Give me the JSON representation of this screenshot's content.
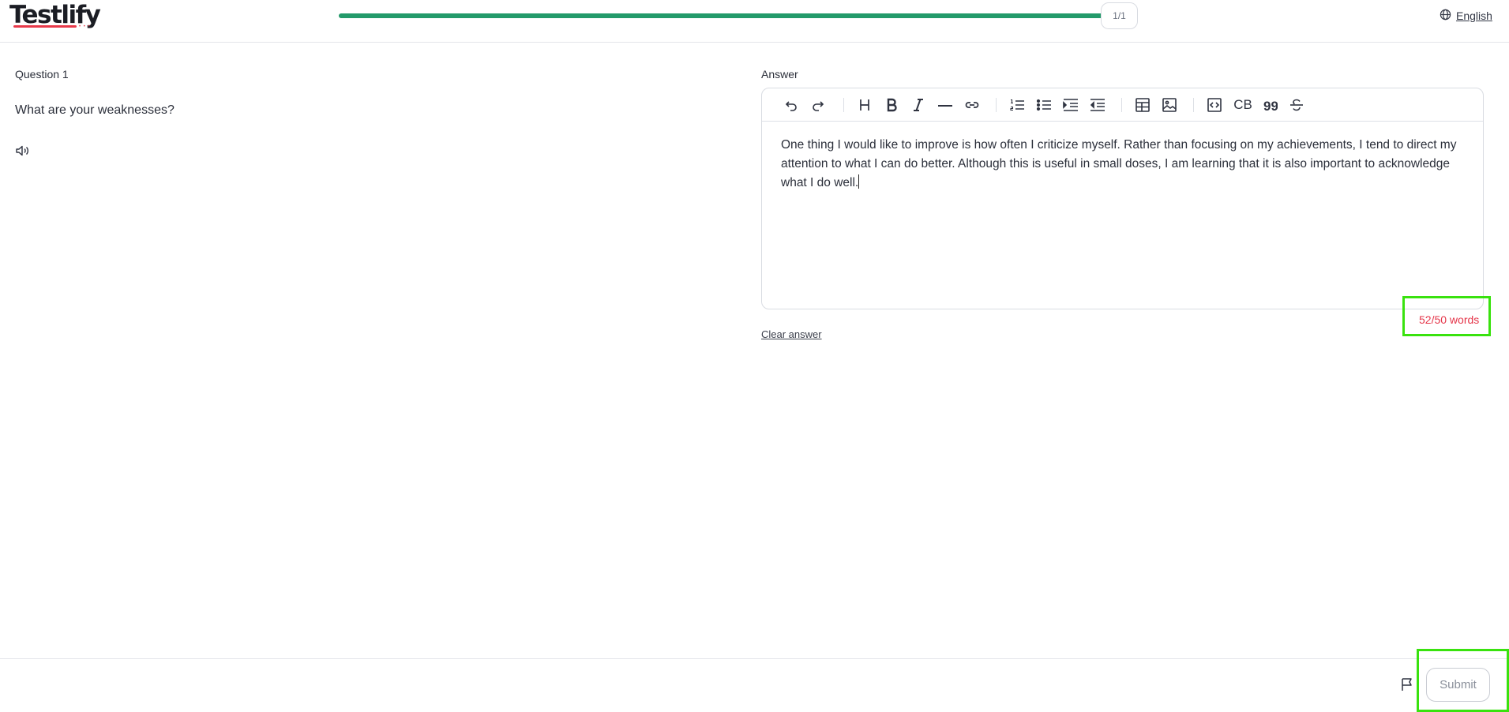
{
  "header": {
    "logo_text": "Testlify",
    "progress_label": "1/1",
    "progress_fraction": 1.0,
    "language": "English",
    "colors": {
      "progress": "#239a6a",
      "brand_accent": "#e8394a"
    }
  },
  "question": {
    "label": "Question 1",
    "text": "What are your weaknesses?",
    "audio_icon": "speaker-icon"
  },
  "answer": {
    "label": "Answer",
    "toolbar": {
      "code_block_label": "CB",
      "icons": [
        "undo-icon",
        "redo-icon",
        "heading-icon",
        "bold-icon",
        "italic-icon",
        "horizontal-rule-icon",
        "link-icon",
        "ordered-list-icon",
        "bullet-list-icon",
        "indent-icon",
        "outdent-icon",
        "table-icon",
        "image-icon",
        "code-icon",
        "code-block-icon",
        "quote-icon",
        "strikethrough-icon"
      ]
    },
    "text": "One thing I would like to improve is how often I criticize myself. Rather than focusing on my achievements, I tend to direct my attention to what I can do better. Although this is useful in small doses, I am learning that it is  also important to acknowledge what I do well.",
    "word_count": "52/50 words",
    "word_count_color": "#e5364a",
    "clear_label": "Clear answer"
  },
  "footer": {
    "submit_label": "Submit",
    "flag_icon": "flag-icon"
  }
}
